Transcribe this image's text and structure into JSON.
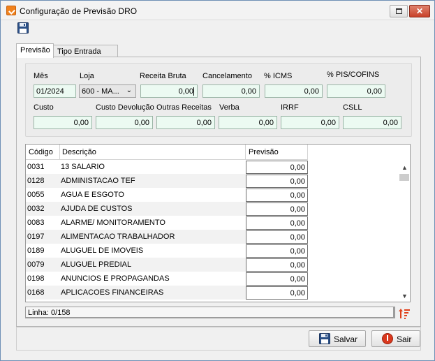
{
  "window": {
    "title": "Configuração de Previsão DRO",
    "close_glyph": "✕",
    "icons": {
      "app": "app-icon",
      "save": "floppy-disk-icon"
    }
  },
  "tabs": [
    {
      "label": "Previsão",
      "active": true
    },
    {
      "label": "Tipo Entrada",
      "active": false
    }
  ],
  "fields": {
    "mes": {
      "label": "Mês",
      "value": "01/2024"
    },
    "loja": {
      "label": "Loja",
      "value": "600 - MA..."
    },
    "receita_bruta": {
      "label": "Receita Bruta",
      "value": "0,00"
    },
    "cancelamento": {
      "label": "Cancelamento",
      "value": "0,00"
    },
    "icms": {
      "label": "% ICMS",
      "value": "0,00"
    },
    "pis_cofins": {
      "label": "% PIS/COFINS",
      "value": "0,00"
    },
    "custo": {
      "label": "Custo",
      "value": "0,00"
    },
    "custo_devolucao": {
      "label": "Custo Devolução",
      "value": "0,00"
    },
    "outras_receitas": {
      "label": "Outras Receitas",
      "value": "0,00"
    },
    "verba": {
      "label": "Verba",
      "value": "0,00"
    },
    "irrf": {
      "label": "IRRF",
      "value": "0,00"
    },
    "csll": {
      "label": "CSLL",
      "value": "0,00"
    }
  },
  "grid": {
    "headers": {
      "codigo": "Código",
      "descricao": "Descrição",
      "previsao": "Previsão"
    },
    "rows": [
      {
        "codigo": "0031",
        "descricao": "13 SALARIO",
        "previsao": "0,00"
      },
      {
        "codigo": "0128",
        "descricao": "ADMINISTACAO TEF",
        "previsao": "0,00"
      },
      {
        "codigo": "0055",
        "descricao": "AGUA E ESGOTO",
        "previsao": "0,00"
      },
      {
        "codigo": "0032",
        "descricao": "AJUDA DE CUSTOS",
        "previsao": "0,00"
      },
      {
        "codigo": "0083",
        "descricao": "ALARME/ MONITORAMENTO",
        "previsao": "0,00"
      },
      {
        "codigo": "0197",
        "descricao": "ALIMENTACAO TRABALHADOR",
        "previsao": "0,00"
      },
      {
        "codigo": "0189",
        "descricao": "ALUGUEL DE IMOVEIS",
        "previsao": "0,00"
      },
      {
        "codigo": "0079",
        "descricao": "ALUGUEL PREDIAL",
        "previsao": "0,00"
      },
      {
        "codigo": "0198",
        "descricao": "ANUNCIOS E PROPAGANDAS",
        "previsao": "0,00"
      },
      {
        "codigo": "0168",
        "descricao": "APLICACOES FINANCEIRAS",
        "previsao": "0,00"
      }
    ]
  },
  "status": {
    "linha": "Linha: 0/158"
  },
  "buttons": {
    "salvar": "Salvar",
    "sair": "Sair"
  }
}
